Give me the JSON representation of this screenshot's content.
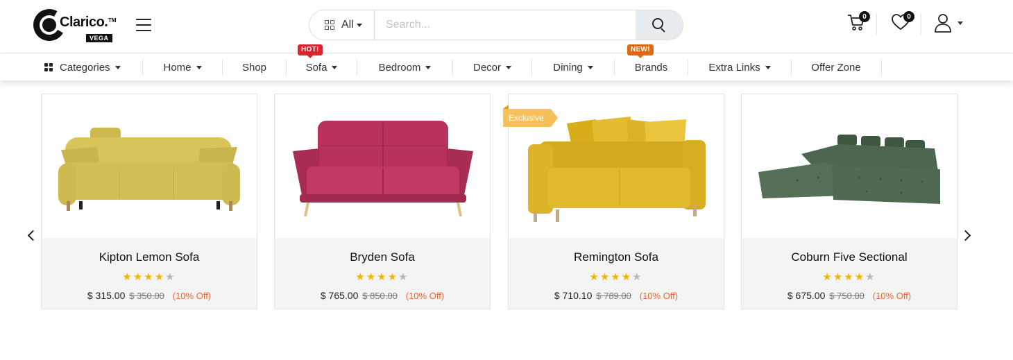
{
  "brand": {
    "name": "Clarico.",
    "tm": "TM",
    "sub": "VEGA"
  },
  "search": {
    "category": "All",
    "placeholder": "Search..."
  },
  "header": {
    "cart_count": "0",
    "wishlist_count": "0"
  },
  "nav": {
    "items": [
      {
        "label": "Categories",
        "has_caret": true
      },
      {
        "label": "Home",
        "has_caret": true
      },
      {
        "label": "Shop",
        "has_caret": false
      },
      {
        "label": "Sofa",
        "has_caret": true,
        "tag": "HOT!"
      },
      {
        "label": "Bedroom",
        "has_caret": true
      },
      {
        "label": "Decor",
        "has_caret": true
      },
      {
        "label": "Dining",
        "has_caret": true
      },
      {
        "label": "Brands",
        "has_caret": false,
        "tag": "NEW!"
      },
      {
        "label": "Extra Links",
        "has_caret": true
      },
      {
        "label": "Offer Zone",
        "has_caret": false
      }
    ]
  },
  "products": [
    {
      "name": "Kipton Lemon Sofa",
      "rating": 4,
      "price": "$ 315.00",
      "old_price": "$ 350.00",
      "discount": "(10% Off)",
      "color": "#d9c45a",
      "ribbon": ""
    },
    {
      "name": "Bryden Sofa",
      "rating": 4,
      "price": "$ 765.00",
      "old_price": "$ 850.00",
      "discount": "(10% Off)",
      "color": "#b8325a",
      "ribbon": ""
    },
    {
      "name": "Remington Sofa",
      "rating": 4,
      "price": "$ 710.10",
      "old_price": "$ 789.00",
      "discount": "(10% Off)",
      "color": "#dfb928",
      "ribbon": "Exclusive"
    },
    {
      "name": "Coburn Five Sectional",
      "rating": 4,
      "price": "$ 675.00",
      "old_price": "$ 750.00",
      "discount": "(10% Off)",
      "color": "#4d6650",
      "ribbon": ""
    }
  ],
  "colors": {
    "star": "#f5b400",
    "discount": "#e8652f",
    "hot": "#d9252b",
    "new": "#e06a10",
    "ribbon": "#f8c05a"
  },
  "icons": {
    "search": "search-icon",
    "cart": "cart-icon",
    "wishlist": "heart-icon",
    "user": "user-icon",
    "menu": "hamburger-icon",
    "prev": "chevron-left-icon",
    "next": "chevron-right-icon"
  }
}
